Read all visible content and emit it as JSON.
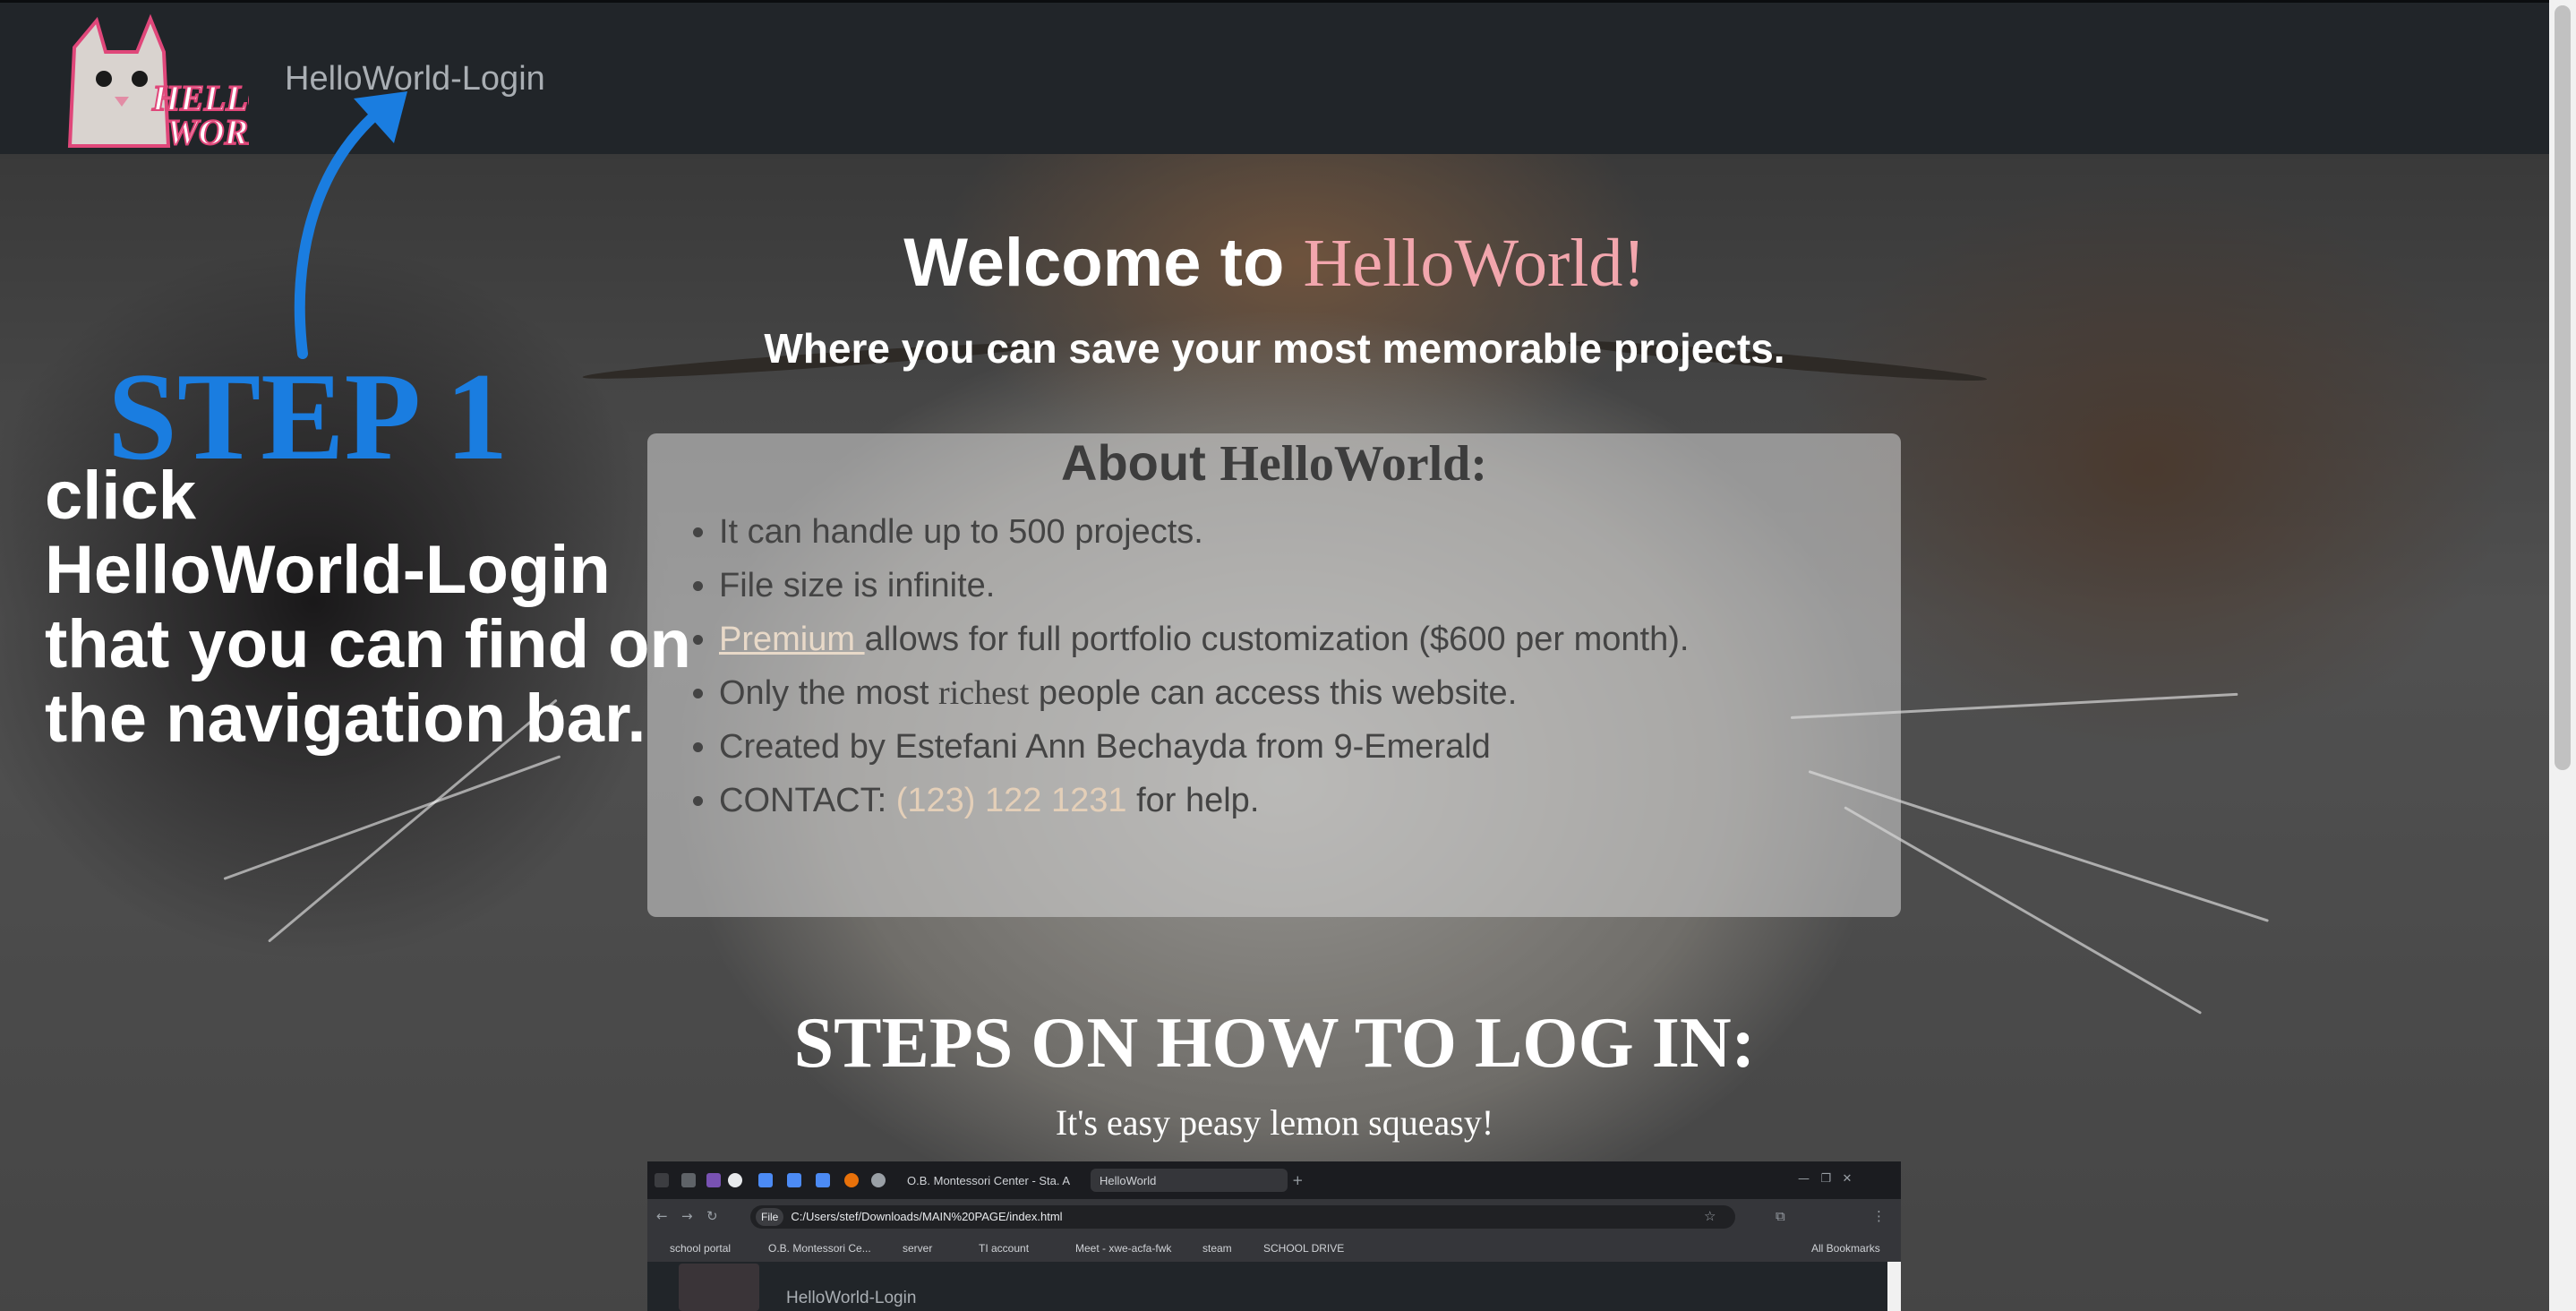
{
  "navbar": {
    "brand": "HelloWorld-Login",
    "logo_icon": "cat-hello-world-logo"
  },
  "hero": {
    "welcome_prefix": "Welcome to ",
    "welcome_brand": "HelloWorld!",
    "tagline": "Where you can save your most memorable projects."
  },
  "about": {
    "title_prefix": "About ",
    "title_brand": "HelloWorld:",
    "items": [
      "It can handle up to 500 projects.",
      "File size is infinite.",
      "Premium ",
      "allows for full portfolio customization ($600 per month).",
      "Only the most ",
      "richest",
      " people can access this website.",
      "Created by Estefani Ann Bechayda from 9-Emerald",
      "CONTACT: ",
      "(123) 122 1231",
      " for help."
    ]
  },
  "steps": {
    "title": "STEPS ON HOW TO LOG IN:",
    "subtitle": "It's easy peasy lemon squeasy!"
  },
  "overlay": {
    "step_label": "STEP 1",
    "instruction_lines": [
      "click",
      "HelloWorld-Login",
      "that you can find on",
      "the navigation bar."
    ],
    "arrow_color": "#1a7de0"
  },
  "embedded_browser": {
    "tab_inactive": "O.B. Montessori Center - Sta. A",
    "tab_active": "HelloWorld",
    "file_chip": "File",
    "url": "C:/Users/stef/Downloads/MAIN%20PAGE/index.html",
    "bookmarks": [
      "school portal",
      "O.B. Montessori Ce...",
      "server",
      "TI account",
      "Meet - xwe-acfa-fwk",
      "steam",
      "SCHOOL DRIVE"
    ],
    "all_bookmarks": "All Bookmarks",
    "page_brand": "HelloWorld-Login"
  },
  "colors": {
    "navbar": "#212529",
    "accent_pink": "#f2a6ad",
    "step_blue": "#1a7de0"
  }
}
